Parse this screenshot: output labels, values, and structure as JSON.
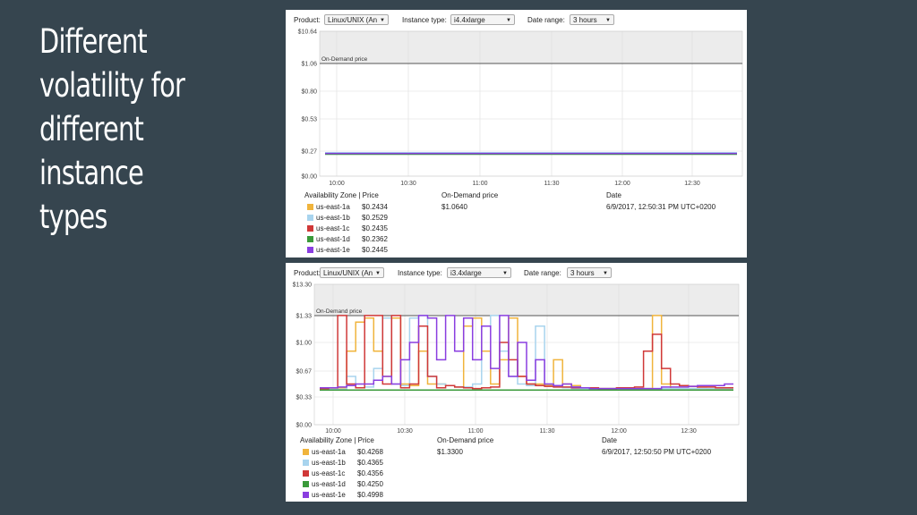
{
  "slide": {
    "title_lines": [
      "Different",
      "volatility for",
      "different",
      "instance",
      "types"
    ]
  },
  "panels": [
    {
      "controls": {
        "product_label": "Product:",
        "product_value": "Linux/UNIX (An",
        "instance_label": "Instance type:",
        "instance_value": "i4.4xlarge",
        "range_label": "Date range:",
        "range_value": "3 hours"
      },
      "legend": {
        "col_zone": "Availability Zone | Price",
        "col_ondemand": "On-Demand price",
        "col_date": "Date",
        "ondemand_value": "$1.0640",
        "date_value": "6/9/2017, 12:50:31 PM UTC+0200",
        "rows": [
          {
            "zone": "us-east-1a",
            "price": "$0.2434"
          },
          {
            "zone": "us-east-1b",
            "price": "$0.2529"
          },
          {
            "zone": "us-east-1c",
            "price": "$0.2435"
          },
          {
            "zone": "us-east-1d",
            "price": "$0.2362"
          },
          {
            "zone": "us-east-1e",
            "price": "$0.2445"
          }
        ]
      }
    },
    {
      "controls": {
        "product_label": "Product:",
        "product_value": "Linux/UNIX (An",
        "instance_label": "Instance type:",
        "instance_value": "i3.4xlarge",
        "range_label": "Date range:",
        "range_value": "3 hours"
      },
      "legend": {
        "col_zone": "Availability Zone | Price",
        "col_ondemand": "On-Demand price",
        "col_date": "Date",
        "ondemand_value": "$1.3300",
        "date_value": "6/9/2017, 12:50:50 PM UTC+0200",
        "rows": [
          {
            "zone": "us-east-1a",
            "price": "$0.4268"
          },
          {
            "zone": "us-east-1b",
            "price": "$0.4365"
          },
          {
            "zone": "us-east-1c",
            "price": "$0.4356"
          },
          {
            "zone": "us-east-1d",
            "price": "$0.4250"
          },
          {
            "zone": "us-east-1e",
            "price": "$0.4998"
          }
        ]
      }
    }
  ],
  "zone_colors": [
    "#f0b43c",
    "#a8d4ee",
    "#d03838",
    "#3a9a3a",
    "#8a3ee0"
  ],
  "chart_data": [
    {
      "type": "line",
      "ylim": [
        0,
        10.64
      ],
      "yticks": [
        {
          "v": 0,
          "label": "$0.00"
        },
        {
          "v": 0.27,
          "label": "$0.27"
        },
        {
          "v": 0.53,
          "label": "$0.53"
        },
        {
          "v": 0.8,
          "label": "$0.80"
        },
        {
          "v": 1.06,
          "label": "$1.06"
        },
        {
          "v": 10.64,
          "label": "$10.64"
        }
      ],
      "xticks": [
        "10:00",
        "10:30",
        "11:00",
        "11:30",
        "12:00",
        "12:30"
      ],
      "on_demand": {
        "label": "On-Demand price",
        "value": 1.064
      },
      "series": [
        {
          "name": "us-east-1a",
          "values": [
            0.2434,
            0.2434
          ]
        },
        {
          "name": "us-east-1b",
          "values": [
            0.2529,
            0.2529
          ]
        },
        {
          "name": "us-east-1c",
          "values": [
            0.2435,
            0.2435
          ]
        },
        {
          "name": "us-east-1d",
          "values": [
            0.2362,
            0.2362
          ]
        },
        {
          "name": "us-east-1e",
          "values": [
            0.2445,
            0.2445
          ]
        }
      ]
    },
    {
      "type": "line",
      "ylim": [
        0,
        13.3
      ],
      "yticks": [
        {
          "v": 0,
          "label": "$0.00"
        },
        {
          "v": 0.33,
          "label": "$0.33"
        },
        {
          "v": 0.67,
          "label": "$0.67"
        },
        {
          "v": 1.0,
          "label": "$1.00"
        },
        {
          "v": 1.33,
          "label": "$1.33"
        },
        {
          "v": 13.3,
          "label": "$13.30"
        }
      ],
      "xticks": [
        "10:00",
        "10:30",
        "11:00",
        "11:30",
        "12:00",
        "12:30"
      ],
      "on_demand": {
        "label": "On-Demand price",
        "value": 1.33
      },
      "series": [
        {
          "name": "us-east-1a",
          "values": [
            0.44,
            0.44,
            0.45,
            0.9,
            1.25,
            1.3,
            0.9,
            0.6,
            1.3,
            0.5,
            0.48,
            0.9,
            0.5,
            0.5,
            0.48,
            0.46,
            1.2,
            1.3,
            0.9,
            0.5,
            0.8,
            1.3,
            0.6,
            0.5,
            0.5,
            0.48,
            0.8,
            0.5,
            0.48,
            0.45,
            0.45,
            0.44,
            0.44,
            0.44,
            0.44,
            0.44,
            0.44,
            1.35,
            0.5,
            0.44,
            0.44,
            0.44,
            0.44,
            0.43,
            0.43,
            0.43,
            0.43
          ]
        },
        {
          "name": "us-east-1b",
          "values": [
            0.42,
            0.43,
            0.43,
            0.6,
            0.45,
            0.46,
            0.7,
            1.3,
            0.5,
            0.48,
            1.3,
            1.35,
            0.6,
            0.5,
            0.48,
            0.46,
            0.46,
            0.5,
            1.2,
            1.35,
            0.9,
            0.6,
            0.5,
            0.48,
            1.2,
            0.5,
            0.46,
            0.45,
            0.44,
            0.44,
            0.44,
            0.44,
            0.44,
            0.44,
            0.44,
            0.44,
            0.44,
            0.44,
            0.44,
            0.44,
            0.44,
            0.44,
            0.44,
            0.44,
            0.44,
            0.44,
            0.44
          ]
        },
        {
          "name": "us-east-1c",
          "values": [
            0.44,
            0.45,
            1.35,
            0.5,
            0.45,
            1.35,
            1.35,
            0.5,
            1.35,
            0.45,
            0.5,
            1.2,
            0.6,
            0.45,
            0.48,
            0.46,
            0.45,
            0.44,
            0.45,
            0.46,
            1.0,
            0.8,
            0.6,
            0.5,
            0.48,
            0.47,
            0.46,
            0.46,
            0.45,
            0.45,
            0.45,
            0.44,
            0.44,
            0.45,
            0.45,
            0.46,
            0.9,
            1.1,
            0.7,
            0.5,
            0.48,
            0.47,
            0.46,
            0.46,
            0.45,
            0.45,
            0.45
          ]
        },
        {
          "name": "us-east-1d",
          "values": [
            0.42,
            0.42,
            0.42,
            0.42,
            0.42,
            0.42,
            0.42,
            0.42,
            0.42,
            0.42,
            0.42,
            0.42,
            0.42,
            0.42,
            0.42,
            0.42,
            0.42,
            0.42,
            0.42,
            0.42,
            0.42,
            0.42,
            0.42,
            0.42,
            0.42,
            0.42,
            0.42,
            0.42,
            0.42,
            0.42,
            0.42,
            0.42,
            0.42,
            0.42,
            0.42,
            0.42,
            0.42,
            0.42,
            0.42,
            0.42,
            0.42,
            0.42,
            0.42,
            0.42,
            0.42,
            0.42,
            0.42
          ]
        },
        {
          "name": "us-east-1e",
          "values": [
            0.45,
            0.45,
            0.46,
            0.48,
            0.5,
            0.5,
            0.55,
            0.6,
            0.5,
            0.8,
            1.0,
            1.35,
            1.3,
            0.8,
            1.35,
            0.9,
            1.3,
            0.8,
            1.2,
            0.7,
            1.35,
            0.6,
            1.0,
            0.55,
            0.8,
            0.5,
            0.48,
            0.5,
            0.46,
            0.45,
            0.44,
            0.44,
            0.44,
            0.44,
            0.44,
            0.44,
            0.44,
            0.44,
            0.46,
            0.46,
            0.46,
            0.47,
            0.48,
            0.48,
            0.48,
            0.5,
            0.5
          ]
        }
      ]
    }
  ]
}
